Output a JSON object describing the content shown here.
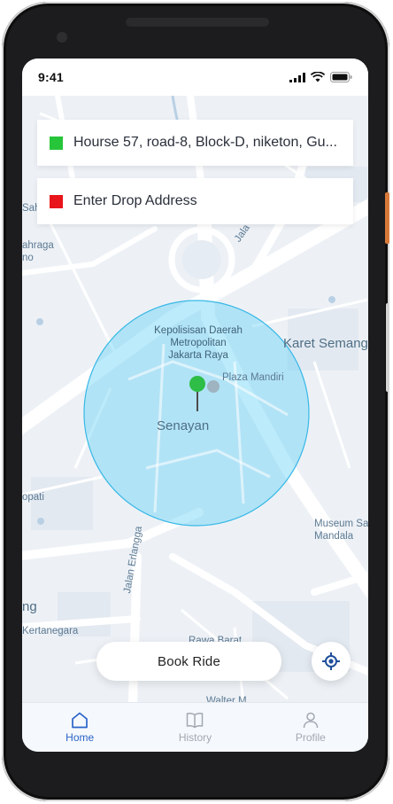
{
  "status_bar": {
    "time": "9:41"
  },
  "pickup": {
    "address": "Hourse 57, road-8, Block-D, niketon, Gu...",
    "marker_color": "#27c53a"
  },
  "dropoff": {
    "placeholder": "Enter Drop Address",
    "marker_color": "#e8151a"
  },
  "map": {
    "labels": {
      "karet": "Karet Semang",
      "police": [
        "Kepolisisan Daerah",
        "Metropolitan",
        "Jakarta Raya"
      ],
      "plaza": "Plaza Mandiri",
      "senayan": "Senayan",
      "museum": [
        "Museum Sa",
        "Mandala"
      ],
      "erlangga": "Jalan Erlangga",
      "kertanegara": "Kertanegara",
      "opati": "opati",
      "ahraga": [
        "ahraga",
        "no"
      ],
      "sahid": "Sahid",
      "jala": "Jala",
      "rawa_barat": "Rawa Barat",
      "walter": "Walter M",
      "ng": "ng"
    },
    "radius_color": "#5fd0f6",
    "pin_color": "#2ebd46"
  },
  "actions": {
    "book_ride": "Book Ride"
  },
  "nav": [
    {
      "label": "Home",
      "icon": "home-icon",
      "active": true
    },
    {
      "label": "History",
      "icon": "book-icon",
      "active": false
    },
    {
      "label": "Profile",
      "icon": "user-icon",
      "active": false
    }
  ],
  "accent_color": "#2a64c9"
}
